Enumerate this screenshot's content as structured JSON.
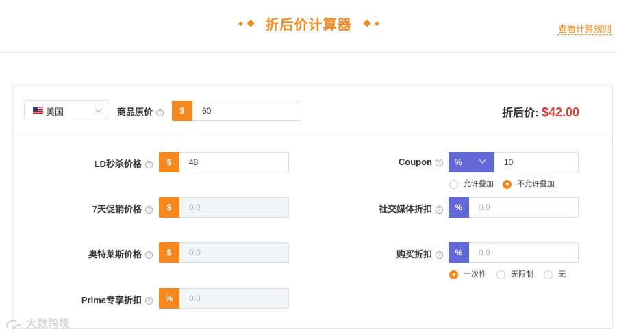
{
  "header": {
    "title": "折后价计算器",
    "rules_link": "查看计算规则"
  },
  "top": {
    "country": "美国",
    "original_price_label": "商品原价",
    "original_price_prefix": "$",
    "original_price_value": "60",
    "result_label": "折后价:",
    "result_value": "$42.00"
  },
  "left_fields": [
    {
      "label": "LD秒杀价格",
      "prefix": "$",
      "value": "48",
      "placeholder": ""
    },
    {
      "label": "7天促销价格",
      "prefix": "$",
      "value": "",
      "placeholder": "0.0"
    },
    {
      "label": "奥特莱斯价格",
      "prefix": "$",
      "value": "",
      "placeholder": "0.0"
    },
    {
      "label": "Prime专享折扣",
      "prefix": "%",
      "value": "",
      "placeholder": "0.0"
    }
  ],
  "coupon": {
    "label": "Coupon",
    "type": "%",
    "value": "10",
    "stack_options": [
      "允许叠加",
      "不允许叠加"
    ],
    "stack_selected": "不允许叠加"
  },
  "social": {
    "label": "社交媒体折扣",
    "prefix": "%",
    "placeholder": "0.0"
  },
  "purchase": {
    "label": "购买折扣",
    "prefix": "%",
    "placeholder": "0.0",
    "options": [
      "一次性",
      "无限制",
      "无"
    ],
    "selected": "一次性"
  },
  "watermark": "大数跨境",
  "colors": {
    "accent": "#f5891f",
    "blue": "#6268d6",
    "result": "#d9453a"
  },
  "help_icon": "?"
}
